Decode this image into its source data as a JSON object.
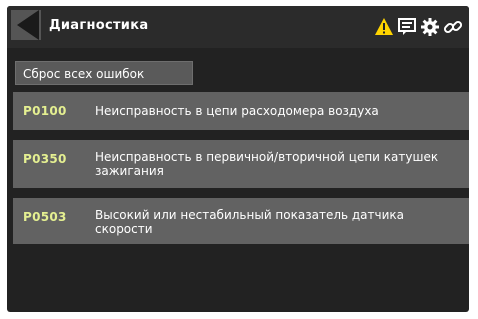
{
  "window": {
    "title": "Диагностика"
  },
  "toolbar": {
    "icons": [
      "warning-icon",
      "message-icon",
      "gear-icon",
      "link-icon"
    ],
    "warning_color": "#ffd400"
  },
  "actions": {
    "reset_label": "Сброс всех ошибок"
  },
  "errors": [
    {
      "code": "P0100",
      "description": "Неисправность в цепи расходомера воздуха"
    },
    {
      "code": "P0350",
      "description": "Неисправность в первичной/вторичной цепи катушек зажигания"
    },
    {
      "code": "P0503",
      "description": "Высокий или нестабильный показатель датчика скорости"
    }
  ],
  "colors": {
    "code_text": "#e4ef91",
    "row_bg": "#626262",
    "screen_bg": "#222222"
  }
}
